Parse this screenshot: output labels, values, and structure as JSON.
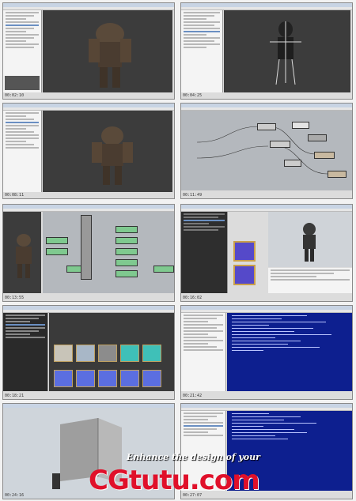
{
  "colors": {
    "accent": "#6a8fc2",
    "code_bg": "#0d1f8f",
    "watermark": "#e0102a",
    "node_green": "#7fc98f"
  },
  "timecodes": [
    "00:02:10",
    "00:04:25",
    "00:08:11",
    "00:11:49",
    "00:13:55",
    "00:16:02",
    "00:18:21",
    "00:21:42",
    "00:24:16",
    "00:27:07"
  ],
  "overlay": {
    "banner": "Enhance the design of your",
    "watermark": "CGtutu.com"
  }
}
